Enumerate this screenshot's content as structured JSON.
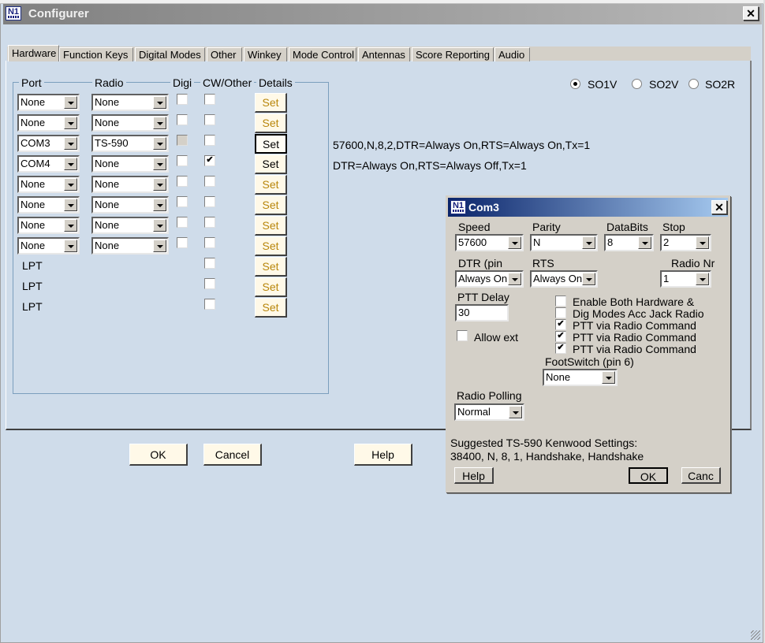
{
  "window": {
    "title": "Configurer",
    "close_label": "✕"
  },
  "tabs": [
    {
      "label": "Hardware",
      "active": true
    },
    {
      "label": "Function Keys"
    },
    {
      "label": "Digital Modes"
    },
    {
      "label": "Other"
    },
    {
      "label": "Winkey"
    },
    {
      "label": "Mode Control"
    },
    {
      "label": "Antennas"
    },
    {
      "label": "Score Reporting"
    },
    {
      "label": "Audio"
    }
  ],
  "hardware": {
    "columns": {
      "port": "Port",
      "radio": "Radio",
      "digi": "Digi",
      "cw_other": "CW/Other",
      "details": "Details"
    },
    "rows": [
      {
        "port": "None",
        "radio": "None",
        "digi": false,
        "cw": false,
        "set": "Set"
      },
      {
        "port": "None",
        "radio": "None",
        "digi": false,
        "cw": false,
        "set": "Set"
      },
      {
        "port": "COM3",
        "radio": "TS-590",
        "digi": false,
        "cw": false,
        "set": "Set",
        "info": "57600,N,8,2,DTR=Always On,RTS=Always On,Tx=1"
      },
      {
        "port": "COM4",
        "radio": "None",
        "digi": false,
        "cw": true,
        "set": "Set",
        "info": "DTR=Always On,RTS=Always Off,Tx=1"
      },
      {
        "port": "None",
        "radio": "None",
        "digi": false,
        "cw": false,
        "set": "Set"
      },
      {
        "port": "None",
        "radio": "None",
        "digi": false,
        "cw": false,
        "set": "Set"
      },
      {
        "port": "None",
        "radio": "None",
        "digi": false,
        "cw": false,
        "set": "Set"
      },
      {
        "port": "None",
        "radio": "None",
        "digi": false,
        "cw": false,
        "set": "Set"
      }
    ],
    "lpt_rows": [
      {
        "label": "LPT",
        "cw": false,
        "set": "Set"
      },
      {
        "label": "LPT",
        "cw": false,
        "set": "Set"
      },
      {
        "label": "LPT",
        "cw": false,
        "set": "Set"
      }
    ],
    "operating_modes": [
      {
        "label": "SO1V",
        "selected": true
      },
      {
        "label": "SO2V",
        "selected": false
      },
      {
        "label": "SO2R",
        "selected": false
      }
    ]
  },
  "buttons": {
    "ok": "OK",
    "cancel": "Cancel",
    "help": "Help"
  },
  "com_dialog": {
    "title": "Com3",
    "close_label": "✕",
    "speed": {
      "label": "Speed",
      "value": "57600"
    },
    "parity": {
      "label": "Parity",
      "value": "N"
    },
    "databits": {
      "label": "DataBits",
      "value": "8"
    },
    "stop": {
      "label": "Stop",
      "value": "2"
    },
    "dtr": {
      "label": "DTR (pin",
      "value": "Always On"
    },
    "rts": {
      "label": "RTS",
      "value": "Always On"
    },
    "radio_nr": {
      "label": "Radio Nr",
      "value": "1"
    },
    "ptt_delay": {
      "label": "PTT Delay",
      "value": "30"
    },
    "allow_ext": {
      "label": "Allow ext",
      "checked": false
    },
    "options": [
      {
        "label": "Enable Both Hardware &",
        "checked": false
      },
      {
        "label": "Dig Modes Acc Jack Radio",
        "checked": false
      },
      {
        "label": "PTT via Radio Command",
        "checked": true
      },
      {
        "label": "PTT via Radio Command",
        "checked": true
      },
      {
        "label": "PTT via Radio Command",
        "checked": true
      }
    ],
    "footswitch": {
      "label": "FootSwitch (pin 6)",
      "value": "None"
    },
    "radio_polling": {
      "label": "Radio Polling",
      "value": "Normal"
    },
    "suggested_line1": "Suggested TS-590 Kenwood Settings:",
    "suggested_line2": "38400, N, 8, 1, Handshake, Handshake",
    "help": "Help",
    "ok": "OK",
    "cancel": "Canc"
  }
}
